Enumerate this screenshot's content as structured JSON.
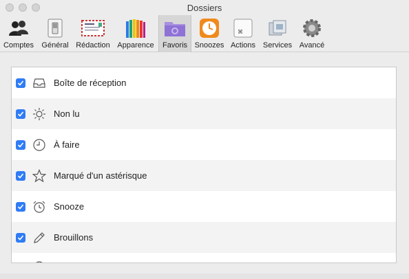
{
  "window": {
    "title": "Dossiers"
  },
  "toolbar": {
    "items": [
      {
        "label": "Comptes",
        "icon": "accounts-icon",
        "active": false
      },
      {
        "label": "Général",
        "icon": "general-switch-icon",
        "active": false
      },
      {
        "label": "Rédaction",
        "icon": "envelope-letter-icon",
        "active": false
      },
      {
        "label": "Apparence",
        "icon": "colored-pencils-icon",
        "active": false
      },
      {
        "label": "Favoris",
        "icon": "folder-gear-icon",
        "active": true
      },
      {
        "label": "Snoozes",
        "icon": "alarm-clock-icon",
        "active": false
      },
      {
        "label": "Actions",
        "icon": "keyboard-command-icon",
        "active": false
      },
      {
        "label": "Services",
        "icon": "services-stack-icon",
        "active": false
      },
      {
        "label": "Avancé",
        "icon": "gear-icon",
        "active": false
      }
    ]
  },
  "folders": [
    {
      "label": "Boîte de réception",
      "checked": true,
      "icon": "inbox-tray-icon"
    },
    {
      "label": "Non lu",
      "checked": true,
      "icon": "sun-icon"
    },
    {
      "label": "À faire",
      "checked": true,
      "icon": "clock-icon"
    },
    {
      "label": "Marqué d'un astérisque",
      "checked": true,
      "icon": "star-icon"
    },
    {
      "label": "Snooze",
      "checked": true,
      "icon": "alarm-clock-icon"
    },
    {
      "label": "Brouillons",
      "checked": true,
      "icon": "pencil-icon"
    }
  ],
  "colors": {
    "accent": "#2f7cf6",
    "active_tab": "#d6d6d6"
  }
}
